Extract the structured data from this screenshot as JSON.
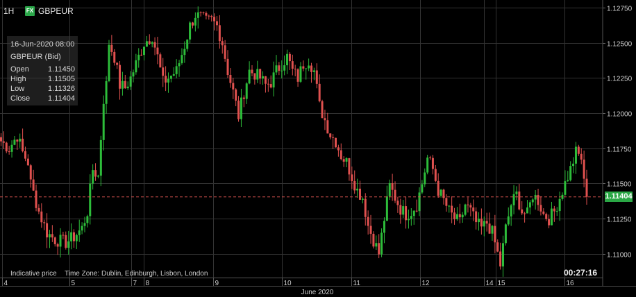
{
  "header": {
    "timeframe": "1H",
    "badge": "FX",
    "symbol": "GBPEUR"
  },
  "tooltip": {
    "datetime": "16-Jun-2020 08:00",
    "series": "GBPEUR (Bid)",
    "rows": [
      {
        "label": "Open",
        "value": "1.11450"
      },
      {
        "label": "High",
        "value": "1.11505"
      },
      {
        "label": "Low",
        "value": "1.11326"
      },
      {
        "label": "Close",
        "value": "1.11404"
      }
    ]
  },
  "footer": {
    "indicative": "Indicative price",
    "timezone": "Time Zone: Dublin, Edinburgh, Lisbon, London",
    "countdown": "00:27:16",
    "month_label": "June 2020"
  },
  "current_price": "1.11404",
  "colors": {
    "up": "#2dbd3a",
    "down": "#e0514f",
    "background": "#000000",
    "grid": "#333333",
    "price_line": "#d9534f",
    "badge": "#2aa745"
  },
  "chart_data": {
    "type": "candlestick",
    "ylim": [
      1.1083,
      1.1278
    ],
    "y_ticks": [
      "1.11000",
      "1.11250",
      "1.11500",
      "1.11750",
      "1.12000",
      "1.12250",
      "1.12500",
      "1.12750"
    ],
    "x_tick_labels": [
      "4",
      "5",
      "7",
      "8",
      "9",
      "10",
      "11",
      "12",
      "14",
      "15",
      "16"
    ],
    "current_price": 1.11404,
    "keypoints": [
      [
        0,
        1.118
      ],
      [
        3,
        1.1175
      ],
      [
        6,
        1.1184
      ],
      [
        8,
        1.1172
      ],
      [
        10,
        1.1165
      ],
      [
        11,
        1.115
      ],
      [
        14,
        1.113
      ],
      [
        17,
        1.1115
      ],
      [
        20,
        1.111
      ],
      [
        24,
        1.1108
      ],
      [
        27,
        1.1112
      ],
      [
        30,
        1.1118
      ],
      [
        32,
        1.113
      ],
      [
        34,
        1.116
      ],
      [
        36,
        1.1155
      ],
      [
        38,
        1.121
      ],
      [
        39,
        1.122
      ],
      [
        40,
        1.125
      ],
      [
        42,
        1.124
      ],
      [
        44,
        1.122
      ],
      [
        46,
        1.1218
      ],
      [
        48,
        1.1225
      ],
      [
        50,
        1.1235
      ],
      [
        53,
        1.125
      ],
      [
        56,
        1.1255
      ],
      [
        58,
        1.124
      ],
      [
        60,
        1.1222
      ],
      [
        62,
        1.1225
      ],
      [
        65,
        1.123
      ],
      [
        68,
        1.1248
      ],
      [
        70,
        1.1262
      ],
      [
        72,
        1.127
      ],
      [
        74,
        1.1268
      ],
      [
        76,
        1.1265
      ],
      [
        78,
        1.1266
      ],
      [
        80,
        1.1262
      ],
      [
        82,
        1.125
      ],
      [
        84,
        1.123
      ],
      [
        86,
        1.1215
      ],
      [
        88,
        1.1198
      ],
      [
        90,
        1.1215
      ],
      [
        92,
        1.123
      ],
      [
        94,
        1.1228
      ],
      [
        96,
        1.1225
      ],
      [
        98,
        1.122
      ],
      [
        100,
        1.1222
      ],
      [
        102,
        1.123
      ],
      [
        104,
        1.1235
      ],
      [
        106,
        1.124
      ],
      [
        108,
        1.123
      ],
      [
        110,
        1.1225
      ],
      [
        112,
        1.1235
      ],
      [
        114,
        1.1238
      ],
      [
        116,
        1.123
      ],
      [
        118,
        1.1205
      ],
      [
        120,
        1.1195
      ],
      [
        122,
        1.1185
      ],
      [
        124,
        1.118
      ],
      [
        126,
        1.117
      ],
      [
        128,
        1.1165
      ],
      [
        130,
        1.1155
      ],
      [
        132,
        1.1145
      ],
      [
        134,
        1.114
      ],
      [
        136,
        1.112
      ],
      [
        138,
        1.111
      ],
      [
        140,
        1.11
      ],
      [
        142,
        1.1125
      ],
      [
        144,
        1.1148
      ],
      [
        146,
        1.114
      ],
      [
        148,
        1.1132
      ],
      [
        150,
        1.1128
      ],
      [
        152,
        1.113
      ],
      [
        154,
        1.1135
      ],
      [
        156,
        1.115
      ],
      [
        158,
        1.1168
      ],
      [
        160,
        1.116
      ],
      [
        162,
        1.1145
      ],
      [
        164,
        1.1138
      ],
      [
        166,
        1.113
      ],
      [
        168,
        1.1125
      ],
      [
        170,
        1.1122
      ],
      [
        172,
        1.1135
      ],
      [
        174,
        1.113
      ],
      [
        176,
        1.1122
      ],
      [
        178,
        1.1118
      ],
      [
        180,
        1.1122
      ],
      [
        182,
        1.1115
      ],
      [
        184,
        1.11
      ],
      [
        185,
        1.1092
      ],
      [
        187,
        1.1118
      ],
      [
        189,
        1.1135
      ],
      [
        191,
        1.1142
      ],
      [
        193,
        1.113
      ],
      [
        195,
        1.1128
      ],
      [
        197,
        1.1142
      ],
      [
        199,
        1.1138
      ],
      [
        201,
        1.1128
      ],
      [
        203,
        1.1125
      ],
      [
        205,
        1.113
      ],
      [
        207,
        1.114
      ],
      [
        209,
        1.115
      ],
      [
        211,
        1.116
      ],
      [
        213,
        1.1172
      ],
      [
        215,
        1.1168
      ],
      [
        216,
        1.115
      ],
      [
        217,
        1.114
      ]
    ]
  }
}
